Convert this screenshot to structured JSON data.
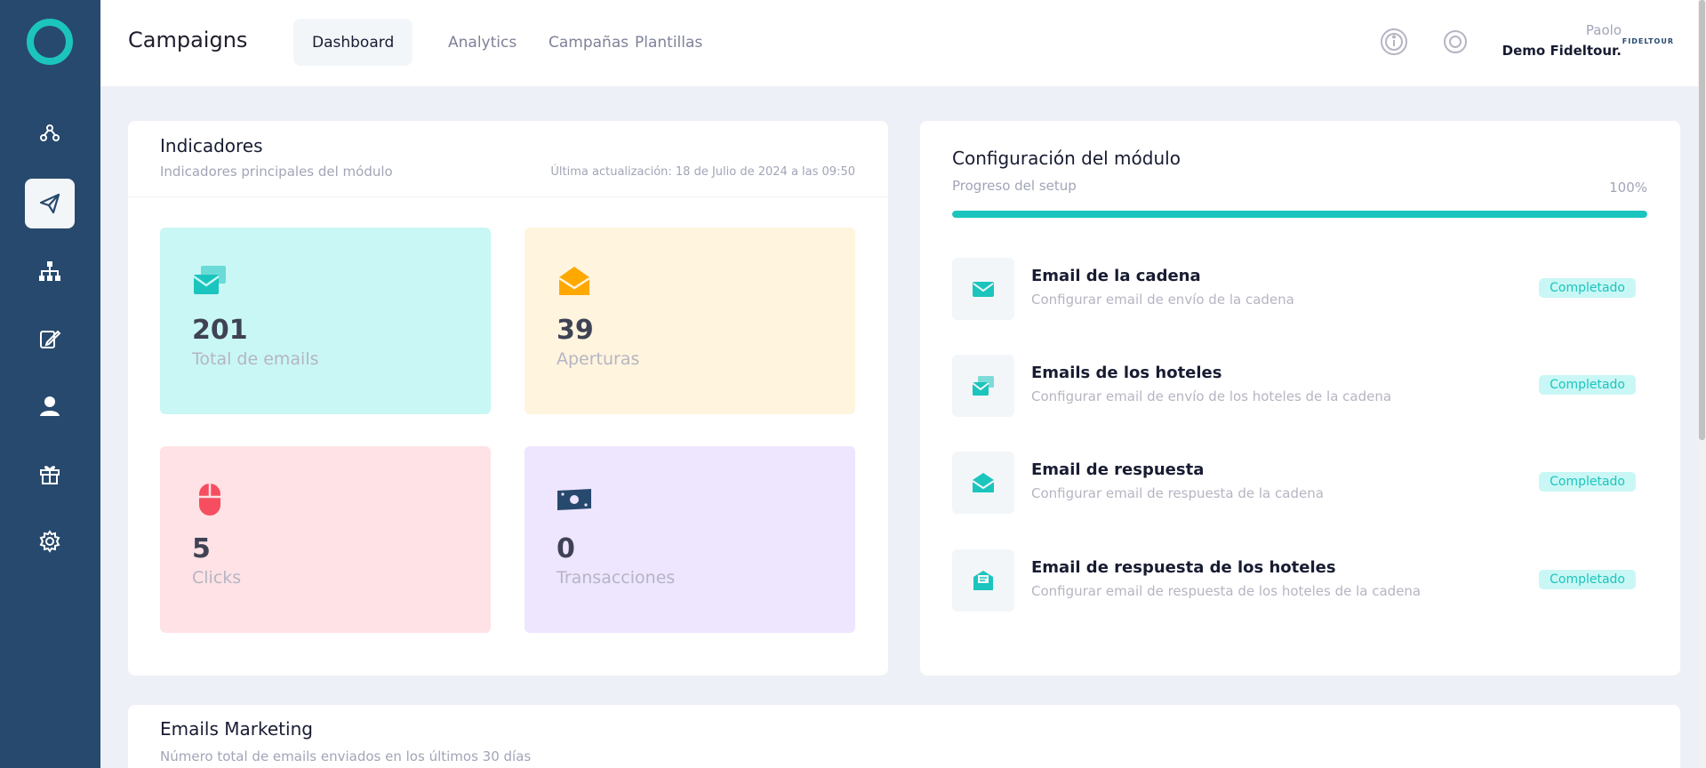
{
  "header": {
    "app_title": "Campaigns",
    "tabs": [
      {
        "label": "Dashboard",
        "active": true
      },
      {
        "label": "Analytics",
        "active": false
      },
      {
        "label": "Campañas",
        "active": false
      },
      {
        "label": "Plantillas",
        "active": false
      }
    ],
    "icons": [
      "info-icon",
      "support-icon"
    ],
    "user": {
      "name": "Paolo",
      "org": "Demo Fideltour."
    },
    "brand_logo_text": "FIDELTOUR"
  },
  "sidebar": {
    "items": [
      {
        "icon": "users-network-icon",
        "active": false
      },
      {
        "icon": "paper-plane-icon",
        "active": true
      },
      {
        "icon": "sitemap-icon",
        "active": false
      },
      {
        "icon": "edit-icon",
        "active": false
      },
      {
        "icon": "user-icon",
        "active": false
      },
      {
        "icon": "gift-icon",
        "active": false
      },
      {
        "icon": "gear-icon",
        "active": false
      }
    ]
  },
  "indicators": {
    "title": "Indicadores",
    "subtitle": "Indicadores principales del módulo",
    "updated": "Última actualización: 18 de Julio de 2024 a las 09:50",
    "stats": [
      {
        "value": "201",
        "label": "Total de emails",
        "icon": "mail-stack-icon",
        "color": "#1bc5bd",
        "bg": "#c9f7f5"
      },
      {
        "value": "39",
        "label": "Aperturas",
        "icon": "open-envelope-icon",
        "color": "#ffa800",
        "bg": "#fff4de"
      },
      {
        "value": "5",
        "label": "Clicks",
        "icon": "mouse-icon",
        "color": "#f64e60",
        "bg": "#ffe2e5"
      },
      {
        "value": "0",
        "label": "Transacciones",
        "icon": "money-icon",
        "color": "#27496d",
        "bg": "#eee5ff"
      }
    ]
  },
  "config": {
    "title": "Configuración del módulo",
    "progress_label": "Progreso del setup",
    "progress_text": "100%",
    "progress_value": 100,
    "items": [
      {
        "title": "Email de la cadena",
        "desc": "Configurar email de envío de la cadena",
        "status": "Completado",
        "icon": "envelope-icon"
      },
      {
        "title": "Emails de los hoteles",
        "desc": "Configurar email de envío de los hoteles de la cadena",
        "status": "Completado",
        "icon": "mail-stack-icon"
      },
      {
        "title": "Email de respuesta",
        "desc": "Configurar email de respuesta de la cadena",
        "status": "Completado",
        "icon": "open-envelope-icon"
      },
      {
        "title": "Email de respuesta de los hoteles",
        "desc": "Configurar email de respuesta de los hoteles de la cadena",
        "status": "Completado",
        "icon": "mail-reply-icon"
      }
    ]
  },
  "marketing": {
    "title": "Emails Marketing",
    "subtitle": "Número total de emails enviados en los últimos 30 días"
  },
  "colors": {
    "accent": "#1bc5bd",
    "sidebar": "#27496d"
  }
}
